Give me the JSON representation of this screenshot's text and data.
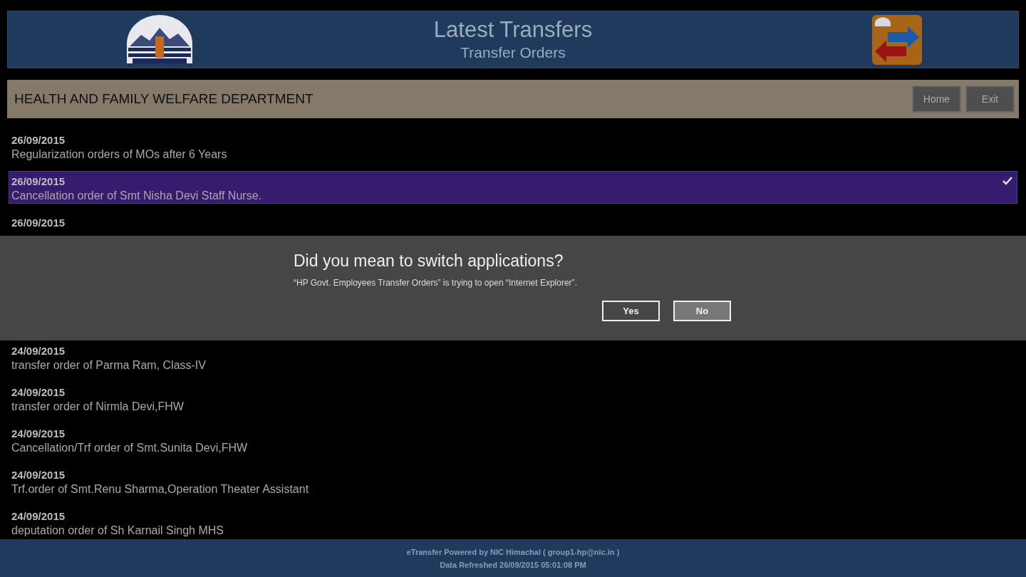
{
  "header": {
    "title": "Latest Transfers",
    "subtitle": "Transfer Orders"
  },
  "department_bar": {
    "title": "HEALTH AND FAMILY WELFARE DEPARTMENT",
    "buttons": [
      "Home",
      "Exit"
    ]
  },
  "list": {
    "items": [
      {
        "date": "26/09/2015",
        "title": "Regularization orders of MOs after 6 Years",
        "selected": false
      },
      {
        "date": "26/09/2015",
        "title": "Cancellation order of Smt Nisha Devi Staff Nurse.",
        "selected": true
      },
      {
        "date": "26/09/2015",
        "selected": false
      },
      {
        "date": "24/09/2015",
        "title": "transfer order of Parma Ram, Class-IV",
        "selected": false
      },
      {
        "date": "24/09/2015",
        "title": "transfer order of Nirmla Devi,FHW",
        "selected": false
      },
      {
        "date": "24/09/2015",
        "title": "Cancellation/Trf order of Smt.Sunita Devi,FHW",
        "selected": false
      },
      {
        "date": "24/09/2015",
        "title": "Trf.order of Smt.Renu Sharma,Operation Theater  Assistant",
        "selected": false
      },
      {
        "date": "24/09/2015",
        "title": "deputation order of Sh Karnail Singh MHS",
        "selected": false
      }
    ]
  },
  "dialog": {
    "title": "Did you mean to switch applications?",
    "message": "“HP Govt. Employees Transfer Orders” is trying to open “Internet Explorer”.",
    "buttons": [
      {
        "label": "Yes",
        "focused": false
      },
      {
        "label": "No",
        "focused": true
      }
    ]
  },
  "footer": {
    "credit": "eTransfer Powered by NIC Himachal ( group1-hp@nic.in )",
    "refreshed": "Data Refreshed 26/09/2015 05:01:08 PM"
  }
}
